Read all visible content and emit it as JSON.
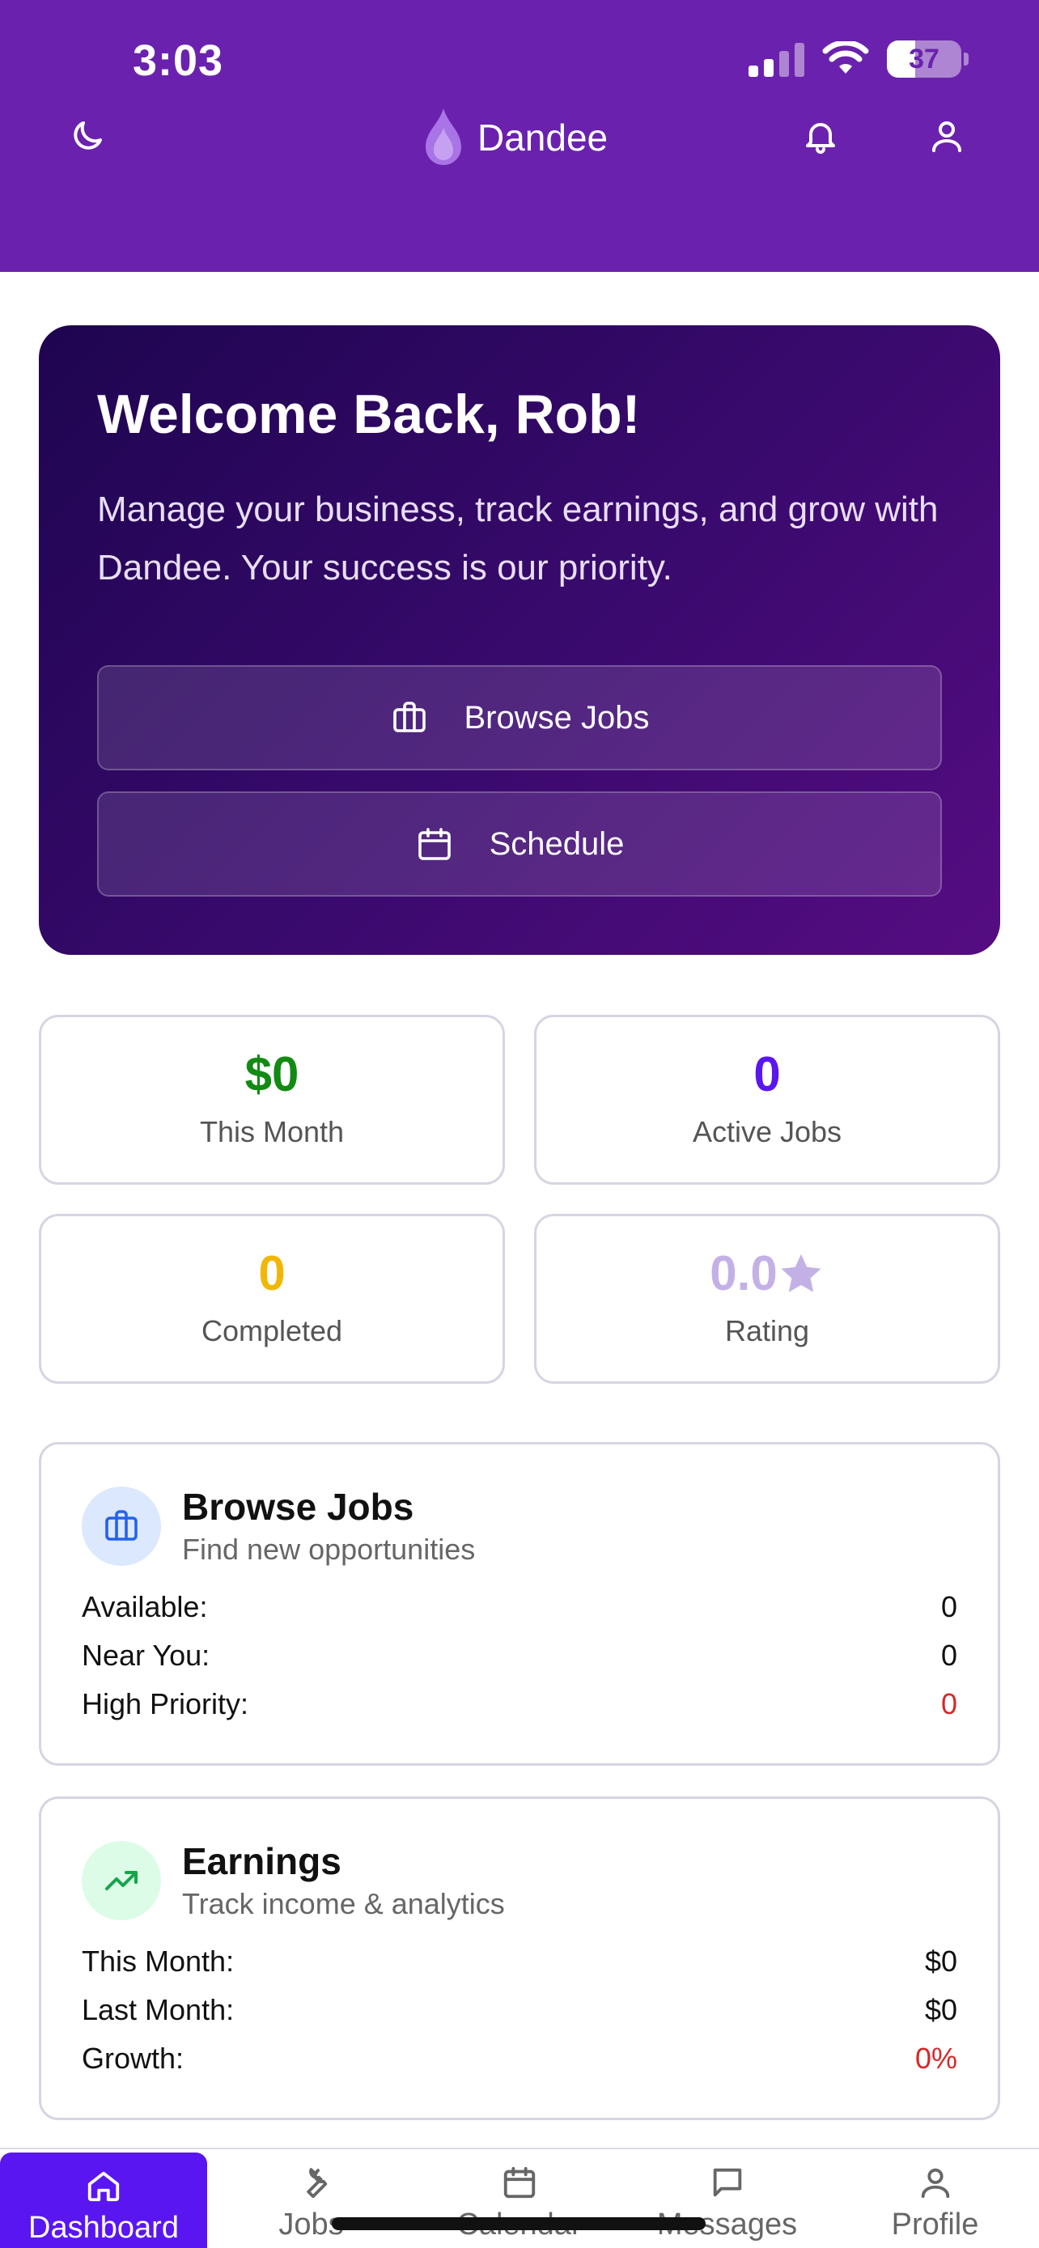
{
  "status_bar": {
    "time": "3:03",
    "battery": "37"
  },
  "header": {
    "brand": "Dandee"
  },
  "hero": {
    "title": "Welcome Back, Rob!",
    "subtitle": "Manage your business, track earnings, and grow with Dandee. Your success is our priority.",
    "browse_label": "Browse Jobs",
    "schedule_label": "Schedule"
  },
  "stats": [
    {
      "value": "$0",
      "label": "This Month",
      "color": "#138a13"
    },
    {
      "value": "0",
      "label": "Active Jobs",
      "color": "#5a16f0"
    },
    {
      "value": "0",
      "label": "Completed",
      "color": "#f2b705"
    },
    {
      "value": "0.0",
      "label": "Rating",
      "color": "#c3b1e6"
    }
  ],
  "browse_card": {
    "title": "Browse Jobs",
    "subtitle": "Find new opportunities",
    "rows": [
      {
        "label": "Available:",
        "value": "0"
      },
      {
        "label": "Near You:",
        "value": "0"
      },
      {
        "label": "High Priority:",
        "value": "0"
      }
    ]
  },
  "earnings_card": {
    "title": "Earnings",
    "subtitle": "Track income & analytics",
    "rows": [
      {
        "label": "This Month:",
        "value": "$0"
      },
      {
        "label": "Last Month:",
        "value": "$0"
      },
      {
        "label": "Growth:",
        "value": "0%"
      }
    ]
  },
  "nav": [
    {
      "label": "Dashboard",
      "icon": "home-icon",
      "active": true
    },
    {
      "label": "Jobs",
      "icon": "wrench-icon"
    },
    {
      "label": "Calendar",
      "icon": "calendar-icon"
    },
    {
      "label": "Messages",
      "icon": "message-icon"
    },
    {
      "label": "Profile",
      "icon": "user-icon"
    }
  ],
  "colors": {
    "header": "#6a22ae",
    "accent": "#5a16f0",
    "danger": "#d62828"
  }
}
